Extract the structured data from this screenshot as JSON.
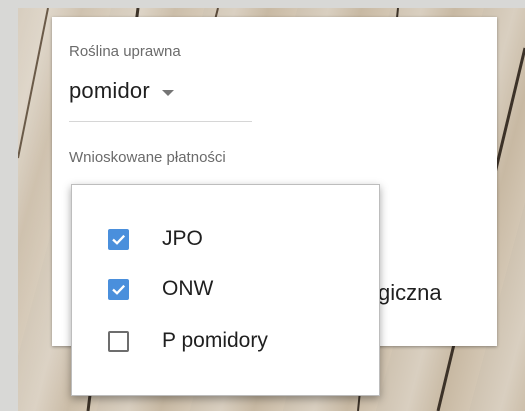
{
  "form": {
    "crop_label": "Roślina uprawna",
    "crop_value": "pomidor",
    "payments_label": "Wnioskowane płatności",
    "partially_hidden_text": "giczna"
  },
  "payments_dropdown": {
    "options": [
      {
        "label": "JPO",
        "checked": true
      },
      {
        "label": "ONW",
        "checked": true
      },
      {
        "label": "P pomidory",
        "checked": false
      }
    ]
  },
  "colors": {
    "checkbox_checked": "#4a8fdc",
    "checkbox_border": "#6d6d6d",
    "text_primary": "#1f1f1f",
    "text_secondary": "#6b6b6b"
  }
}
